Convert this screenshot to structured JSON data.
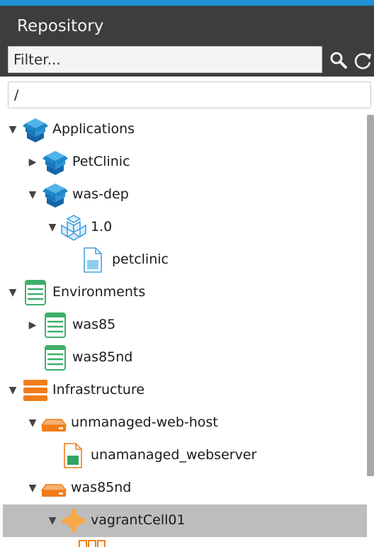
{
  "header": {
    "title": "Repository",
    "filter_placeholder": "Filter...",
    "search_icon": "search-icon",
    "refresh_icon": "refresh-icon"
  },
  "path": {
    "value": "/"
  },
  "tree": {
    "items": [
      {
        "label": "Applications",
        "icon": "application-icon"
      },
      {
        "label": "PetClinic",
        "icon": "application-icon"
      },
      {
        "label": "was-dep",
        "icon": "application-icon"
      },
      {
        "label": "1.0",
        "icon": "version-icon"
      },
      {
        "label": "petclinic",
        "icon": "file-icon"
      },
      {
        "label": "Environments",
        "icon": "environment-icon"
      },
      {
        "label": "was85",
        "icon": "environment-icon"
      },
      {
        "label": "was85nd",
        "icon": "environment-icon"
      },
      {
        "label": "Infrastructure",
        "icon": "infrastructure-icon"
      },
      {
        "label": "unmanaged-web-host",
        "icon": "host-icon"
      },
      {
        "label": "unamanaged_webserver",
        "icon": "container-icon"
      },
      {
        "label": "was85nd",
        "icon": "host-icon"
      },
      {
        "label": "vagrantCell01",
        "icon": "cell-icon"
      }
    ]
  },
  "colors": {
    "accent": "#1f8fd6",
    "header_bg": "#3d3d3d",
    "selected_row": "#bdbdbd",
    "application_blue": "#1e88c8",
    "environment_green": "#3fae6a",
    "infrastructure_orange": "#f07d1a"
  }
}
